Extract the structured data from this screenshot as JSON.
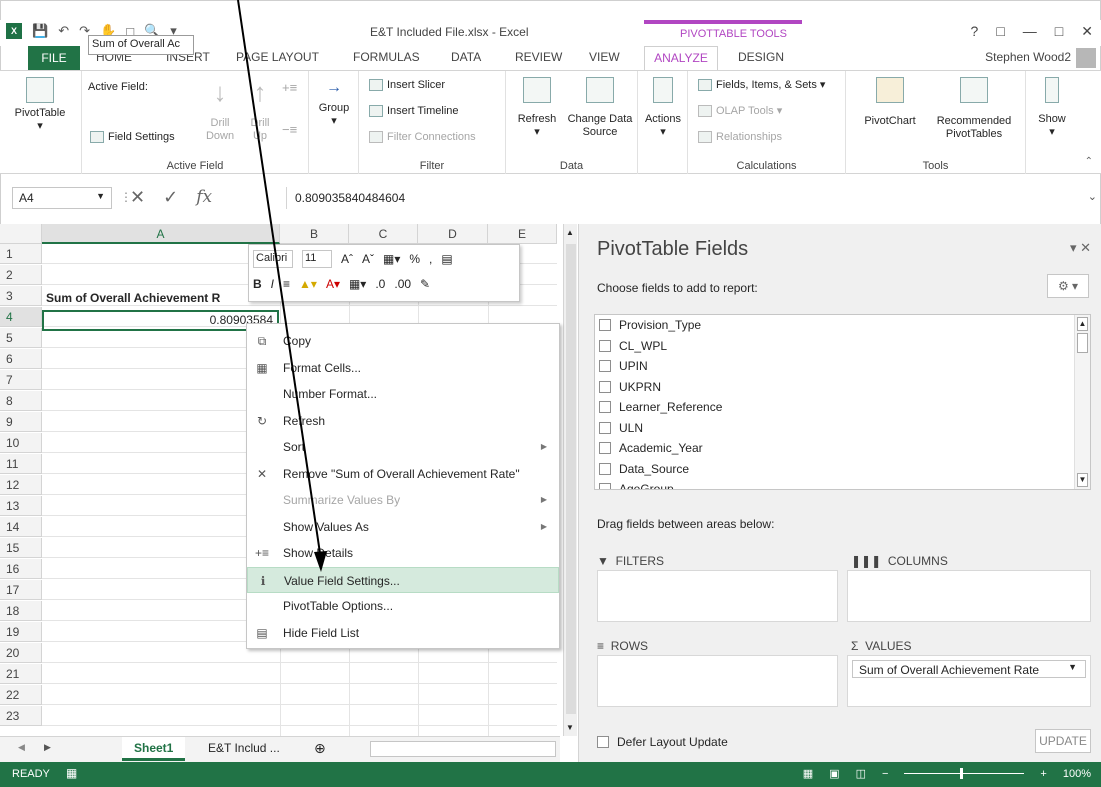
{
  "window": {
    "title": "E&T Included File.xlsx - Excel",
    "contextual_group": "PIVOTTABLE TOOLS",
    "account": "Stephen Wood2",
    "help": "?",
    "restore_ribbon": "□",
    "minimize": "—",
    "maximize": "□",
    "close": "✕"
  },
  "tabs": [
    "FILE",
    "HOME",
    "INSERT",
    "PAGE LAYOUT",
    "FORMULAS",
    "DATA",
    "REVIEW",
    "VIEW",
    "ANALYZE",
    "DESIGN"
  ],
  "ribbon": {
    "pivottable": "PivotTable",
    "active_field_label": "Active Field:",
    "active_field_value": "Sum of Overall Ac",
    "field_settings": "Field Settings",
    "drill_down": "Drill Down",
    "drill_up": "Drill Up",
    "active_field_group": "Active Field",
    "group": "Group",
    "insert_slicer": "Insert Slicer",
    "insert_timeline": "Insert Timeline",
    "filter_connections": "Filter Connections",
    "filter_group": "Filter",
    "refresh": "Refresh",
    "change_data_source": "Change Data Source",
    "data_group": "Data",
    "actions": "Actions",
    "fields_items_sets": "Fields, Items, & Sets",
    "olap_tools": "OLAP Tools",
    "relationships": "Relationships",
    "calculations_group": "Calculations",
    "pivotchart": "PivotChart",
    "recommended_pivottables": "Recommended PivotTables",
    "tools_group": "Tools",
    "show": "Show"
  },
  "formula_bar": {
    "name_box": "A4",
    "fx": "fx",
    "value": "0.809035840484604"
  },
  "sheet": {
    "columns": [
      "A",
      "B",
      "C",
      "D",
      "E"
    ],
    "rows": [
      "1",
      "2",
      "3",
      "4",
      "5",
      "6",
      "7",
      "8",
      "9",
      "10",
      "11",
      "12",
      "13",
      "14",
      "15",
      "16",
      "17",
      "18",
      "19",
      "20",
      "21",
      "22",
      "23"
    ],
    "a3": "Sum of Overall Achievement R",
    "a4": "0.80903584"
  },
  "sheet_tabs": {
    "active": "Sheet1",
    "other": "E&T Includ ...",
    "add": "⊕"
  },
  "status": {
    "ready": "READY",
    "zoom": "100%"
  },
  "mini_toolbar": {
    "font": "Calibri",
    "size": "11"
  },
  "context_menu": [
    {
      "label": "Copy",
      "icon": "copy-icon",
      "glyph": "⧉",
      "disabled": false,
      "sub": false
    },
    {
      "label": "Format Cells...",
      "icon": "format-cells-icon",
      "glyph": "▦",
      "disabled": false,
      "sub": false
    },
    {
      "label": "Number Format...",
      "icon": "",
      "glyph": "",
      "disabled": false,
      "sub": false
    },
    {
      "label": "Refresh",
      "icon": "refresh-icon",
      "glyph": "↻",
      "disabled": false,
      "sub": false
    },
    {
      "label": "Sort",
      "icon": "",
      "glyph": "",
      "disabled": false,
      "sub": true
    },
    {
      "label": "Remove \"Sum of Overall Achievement Rate\"",
      "icon": "remove-icon",
      "glyph": "✕",
      "disabled": false,
      "sub": false
    },
    {
      "label": "Summarize Values By",
      "icon": "",
      "glyph": "",
      "disabled": true,
      "sub": true
    },
    {
      "label": "Show Values As",
      "icon": "",
      "glyph": "",
      "disabled": false,
      "sub": true
    },
    {
      "label": "Show Details",
      "icon": "show-details-icon",
      "glyph": "+≡",
      "disabled": false,
      "sub": false
    },
    {
      "label": "Value Field Settings...",
      "icon": "value-field-settings-icon",
      "glyph": "ℹ",
      "disabled": false,
      "sub": false,
      "highlighted": true
    },
    {
      "label": "PivotTable Options...",
      "icon": "",
      "glyph": "",
      "disabled": false,
      "sub": false
    },
    {
      "label": "Hide Field List",
      "icon": "hide-field-list-icon",
      "glyph": "▤",
      "disabled": false,
      "sub": false
    }
  ],
  "pivot_pane": {
    "title": "PivotTable Fields",
    "choose": "Choose fields to add to report:",
    "fields": [
      "Provision_Type",
      "CL_WPL",
      "UPIN",
      "UKPRN",
      "Learner_Reference",
      "ULN",
      "Academic_Year",
      "Data_Source",
      "AgeGroup"
    ],
    "drag_label": "Drag fields between areas below:",
    "filters": "FILTERS",
    "columns": "COLUMNS",
    "rows": "ROWS",
    "values": "VALUES",
    "values_item": "Sum of Overall Achievement Rate",
    "defer": "Defer Layout Update",
    "update": "UPDATE"
  },
  "colors": {
    "excel_green": "#217346",
    "pivot_accent": "#b146c2",
    "menu_highlight": "#d5eadd"
  }
}
